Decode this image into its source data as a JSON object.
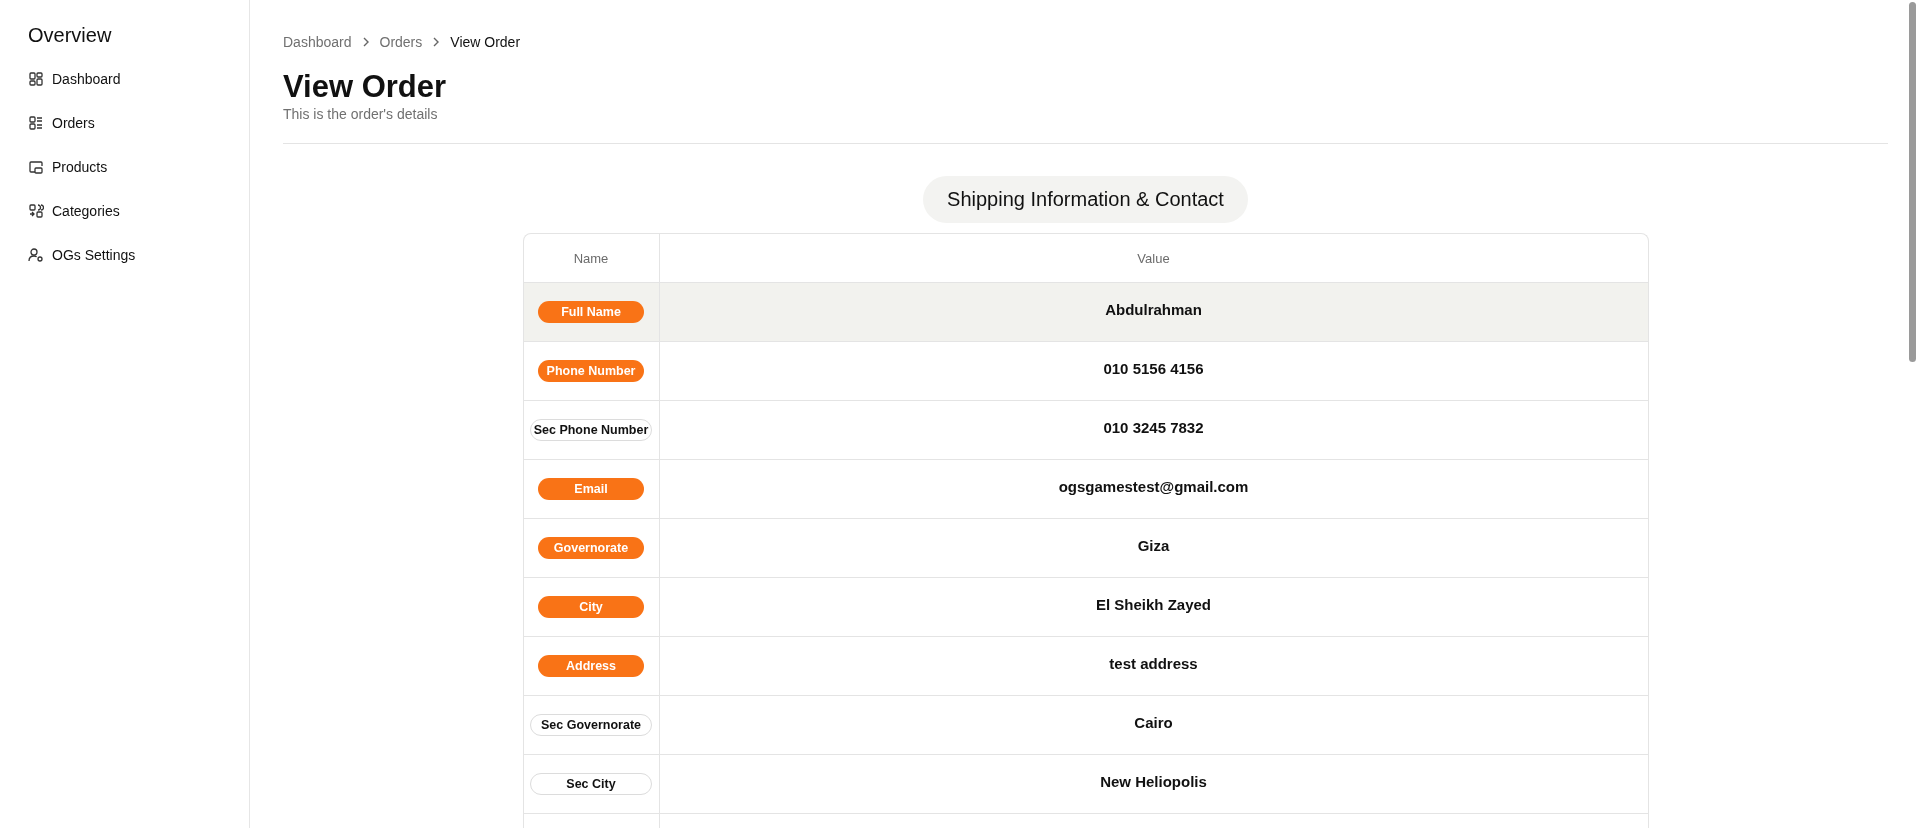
{
  "sidebar": {
    "title": "Overview",
    "items": [
      {
        "label": "Dashboard",
        "selected": false
      },
      {
        "label": "Orders",
        "selected": false
      },
      {
        "label": "Products",
        "selected": false
      },
      {
        "label": "Categories",
        "selected": false
      },
      {
        "label": "OGs Settings",
        "selected": false
      }
    ]
  },
  "breadcrumb": [
    {
      "label": "Dashboard",
      "current": false
    },
    {
      "label": "Orders",
      "current": false
    },
    {
      "label": "View Order",
      "current": true
    }
  ],
  "header": {
    "title": "View Order",
    "subtitle": "This is the order's details"
  },
  "section": {
    "title": "Shipping Information & Contact"
  },
  "table": {
    "columns": [
      "Name",
      "Value"
    ],
    "rows": [
      {
        "name": "Full Name",
        "kind": "filled",
        "value": "Abdulrahman",
        "selected": true
      },
      {
        "name": "Phone Number",
        "kind": "filled",
        "value": "010 5156 4156",
        "selected": false
      },
      {
        "name": "Sec Phone Number",
        "kind": "outline",
        "value": "010 3245 7832",
        "selected": false
      },
      {
        "name": "Email",
        "kind": "filled",
        "value": "ogsgamestest@gmail.com",
        "selected": false
      },
      {
        "name": "Governorate",
        "kind": "filled",
        "value": "Giza",
        "selected": false
      },
      {
        "name": "City",
        "kind": "filled",
        "value": "El Sheikh Zayed",
        "selected": false
      },
      {
        "name": "Address",
        "kind": "filled",
        "value": "test address",
        "selected": false
      },
      {
        "name": "Sec Governorate",
        "kind": "outline",
        "value": "Cairo",
        "selected": false
      },
      {
        "name": "Sec City",
        "kind": "outline",
        "value": "New Heliopolis",
        "selected": false
      }
    ]
  }
}
